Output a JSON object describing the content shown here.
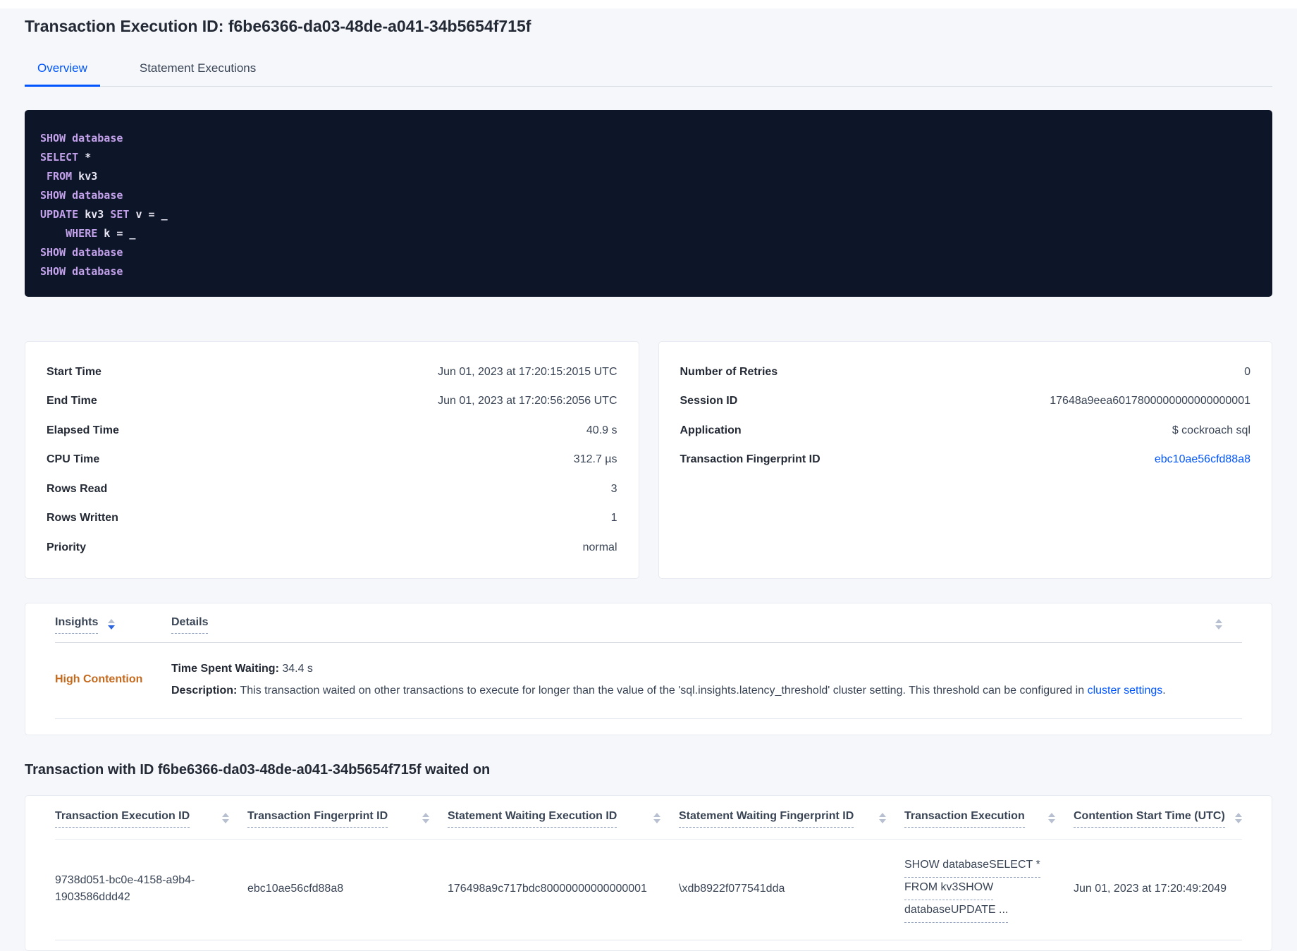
{
  "page_title": "Transaction Execution ID: f6be6366-da03-48de-a041-34b5654f715f",
  "colors": {
    "accent_blue": "#0055ff",
    "warning_orange": "#c5691c",
    "code_bg": "#0d1628",
    "keyword_purple": "#c2a1ea"
  },
  "tabs": {
    "overview": "Overview",
    "statement_executions": "Statement Executions"
  },
  "sql": {
    "lines": [
      [
        {
          "t": "SHOW database",
          "k": 1
        }
      ],
      [
        {
          "t": "SELECT",
          "k": 1
        },
        {
          "t": " *",
          "k": 0
        }
      ],
      [
        {
          "t": " ",
          "k": 0
        },
        {
          "t": "FROM",
          "k": 1
        },
        {
          "t": " kv3",
          "k": 0
        }
      ],
      [
        {
          "t": "SHOW database",
          "k": 1
        }
      ],
      [
        {
          "t": "UPDATE",
          "k": 1
        },
        {
          "t": " kv3 ",
          "k": 0
        },
        {
          "t": "SET",
          "k": 1
        },
        {
          "t": " v = _",
          "k": 0
        }
      ],
      [
        {
          "t": "    ",
          "k": 0
        },
        {
          "t": "WHERE",
          "k": 1
        },
        {
          "t": " k = _",
          "k": 0
        }
      ],
      [
        {
          "t": "SHOW database",
          "k": 1
        }
      ],
      [
        {
          "t": "SHOW database",
          "k": 1
        }
      ]
    ]
  },
  "summary_left": {
    "rows": [
      {
        "label": "Start Time",
        "value": "Jun 01, 2023 at 17:20:15:2015 UTC"
      },
      {
        "label": "End Time",
        "value": "Jun 01, 2023 at 17:20:56:2056 UTC"
      },
      {
        "label": "Elapsed Time",
        "value": "40.9 s"
      },
      {
        "label": "CPU Time",
        "value": "312.7 µs"
      },
      {
        "label": "Rows Read",
        "value": "3"
      },
      {
        "label": "Rows Written",
        "value": "1"
      },
      {
        "label": "Priority",
        "value": "normal"
      }
    ]
  },
  "summary_right": {
    "rows": [
      {
        "label": "Number of Retries",
        "value": "0"
      },
      {
        "label": "Session ID",
        "value": "17648a9eea6017800000000000000001"
      },
      {
        "label": "Application",
        "value": "$ cockroach sql"
      },
      {
        "label": "Transaction Fingerprint ID",
        "value": "ebc10ae56cfd88a8"
      }
    ]
  },
  "insights": {
    "col_insights": "Insights",
    "col_details": "Details",
    "row": {
      "insight": "High Contention",
      "waiting_label": "Time Spent Waiting:",
      "waiting_value": " 34.4 s",
      "description_label": "Description:",
      "description_text": " This transaction waited on other transactions to execute for longer than the value of the 'sql.insights.latency_threshold' cluster setting. This threshold can be configured in ",
      "description_link": "cluster settings",
      "description_suffix": "."
    }
  },
  "waited_section": {
    "title": "Transaction with ID f6be6366-da03-48de-a041-34b5654f715f waited on",
    "headers": {
      "transaction_execution_id": "Transaction Execution ID",
      "transaction_fingerprint_id": "Transaction Fingerprint ID",
      "statement_waiting_execution_id": "Statement Waiting Execution ID",
      "statement_waiting_fingerprint_id": "Statement Waiting Fingerprint ID",
      "transaction_execution": "Transaction Execution",
      "contention_start_time": "Contention Start Time (UTC)"
    },
    "row": {
      "transaction_execution_id": "9738d051-bc0e-4158-a9b4-1903586ddd42",
      "transaction_fingerprint_id": "ebc10ae56cfd88a8",
      "statement_waiting_execution_id": "176498a9c717bdc80000000000000001",
      "statement_waiting_fingerprint_id": "\\xdb8922f077541dda",
      "transaction_execution_lines": [
        "SHOW databaseSELECT *",
        "FROM kv3SHOW",
        "databaseUPDATE ..."
      ],
      "contention_start_time": "Jun 01, 2023 at 17:20:49:2049"
    }
  }
}
